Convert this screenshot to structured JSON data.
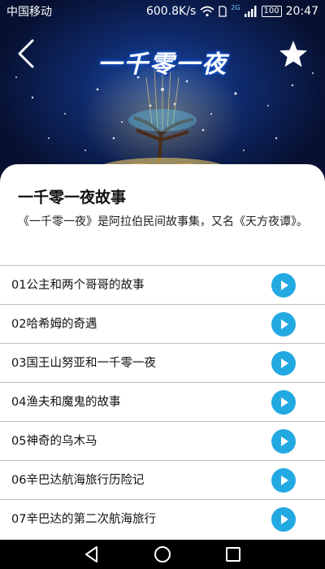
{
  "status_bar": {
    "carrier": "中国移动",
    "speed": "600.8K/s",
    "network": "2G",
    "battery": "100",
    "time": "20:47"
  },
  "header": {
    "title": "一千零一夜",
    "back_icon": "chevron-left-icon",
    "favorite_icon": "star-icon"
  },
  "book": {
    "title": "一千零一夜故事",
    "description": "《一千零一夜》是阿拉伯民间故事集，又名《天方夜谭》。"
  },
  "stories": [
    {
      "label": "01公主和两个哥哥的故事"
    },
    {
      "label": "02哈希姆的奇遇"
    },
    {
      "label": "03国王山努亚和一千零一夜"
    },
    {
      "label": "04渔夫和魔鬼的故事"
    },
    {
      "label": "05神奇的乌木马"
    },
    {
      "label": "06辛巴达航海旅行历险记"
    },
    {
      "label": "07辛巴达的第二次航海旅行"
    }
  ],
  "colors": {
    "play_button": "#23a9e1",
    "hero_background": "#0f2a6b"
  },
  "navigation": {
    "back_icon": "triangle-back-icon",
    "home_icon": "circle-home-icon",
    "recents_icon": "square-recents-icon"
  }
}
